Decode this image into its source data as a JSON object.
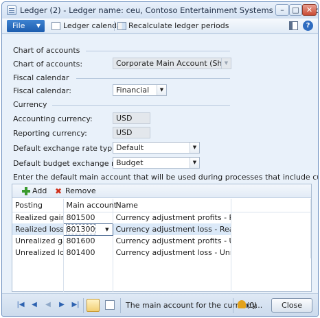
{
  "window": {
    "title": "Ledger (2) - Ledger name: ceu, Contoso Entertainment Systems (West), Ledger: ceu",
    "minimize": "–",
    "maximize": "□",
    "close": "✕"
  },
  "toolbar": {
    "file_label": "File",
    "file_caret": "▼",
    "ledger_calendar_label": "Ledger calendar",
    "recalculate_label": "Recalculate ledger periods",
    "help": "?"
  },
  "sections": {
    "chart_of_accounts": {
      "header": "Chart of accounts",
      "label": "Chart of accounts:",
      "value": "Corporate Main Account (Shared)"
    },
    "fiscal_calendar": {
      "header": "Fiscal calendar",
      "label": "Fiscal calendar:",
      "value": "Financial"
    },
    "currency": {
      "header": "Currency",
      "accounting_label": "Accounting currency:",
      "accounting_value": "USD",
      "reporting_label": "Reporting currency:",
      "reporting_value": "USD",
      "rate_type_label": "Default exchange rate type:",
      "rate_type_value": "Default",
      "budget_rate_type_label": "Default budget exchange rate type:",
      "budget_rate_type_value": "Budget"
    }
  },
  "note": "Enter the default main account that will be used during processes that include currency revaluation.",
  "grid": {
    "add_label": "Add",
    "remove_label": "Remove",
    "columns": [
      "Posting",
      "Main account",
      "Name"
    ],
    "rows": [
      {
        "posting": "Realized gain",
        "account": "801500",
        "name": "Currency adjustment profits - Realized"
      },
      {
        "posting": "Realized loss",
        "account": "801300",
        "name": "Currency adjustment loss - Realized"
      },
      {
        "posting": "Unrealized gain",
        "account": "801600",
        "name": "Currency adjustment profits - Unrealized"
      },
      {
        "posting": "Unrealized loss",
        "account": "801400",
        "name": "Currency adjustment loss - Unrealized"
      }
    ],
    "selected_row": 1
  },
  "statusbar": {
    "nav_first": "|◀",
    "nav_prev": "◀",
    "nav_up": "◀",
    "nav_next": "▶",
    "nav_last": "▶|",
    "message": "The main account for the currency...",
    "alerts": "(0)",
    "close_label": "Close"
  },
  "colors": {
    "accent": "#1c5cae",
    "window_bg": "#e9f1fa",
    "selected_row": "#dbe9f8"
  }
}
